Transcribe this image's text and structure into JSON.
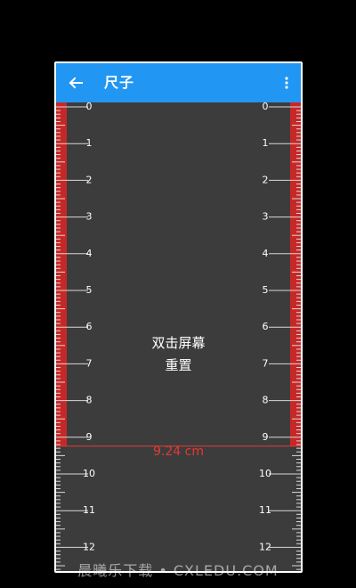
{
  "appbar": {
    "title": "尺子",
    "back_icon": "arrow-left-icon",
    "menu_icon": "more-vert-icon",
    "color": "#2196f3"
  },
  "ruler": {
    "unit": "cm",
    "labels": [
      "0",
      "1",
      "2",
      "3",
      "4",
      "5",
      "6",
      "7",
      "8",
      "9",
      "10",
      "11",
      "12"
    ],
    "measured_cm": 9.24,
    "highlight_color": "#c62828",
    "line_color": "#e53935"
  },
  "hint": {
    "line1": "双击屏幕",
    "line2": "重置"
  },
  "measurement": {
    "text": "9.24 cm"
  },
  "watermark": {
    "text": "晨曦乐下载 • CXLEDU.COM"
  }
}
